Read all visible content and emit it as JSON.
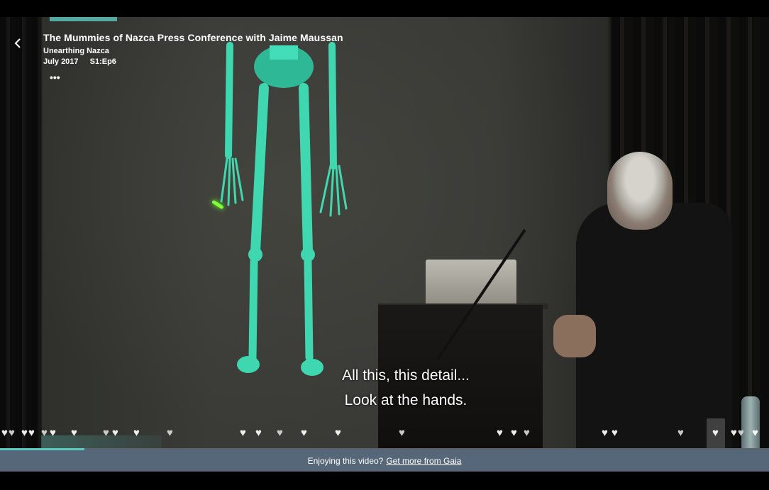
{
  "video": {
    "title": "The Mummies of Nazca Press Conference with Jaime Maussan",
    "series": "Unearthing Nazca",
    "date": "July 2017",
    "episode": "S1:Ep6",
    "more_icon": "ellipsis-icon",
    "back_icon": "chevron-left-icon",
    "progress": 0.11,
    "accent_color": "#5ec9c0"
  },
  "subtitles": {
    "line1": "All this, this detail...",
    "line2": "Look at the hands."
  },
  "reactions": {
    "icon": "heart-icon",
    "count": 27
  },
  "promo": {
    "text": "Enjoying this video?",
    "link": "Get more from Gaia",
    "bar_color": "#56677a"
  }
}
